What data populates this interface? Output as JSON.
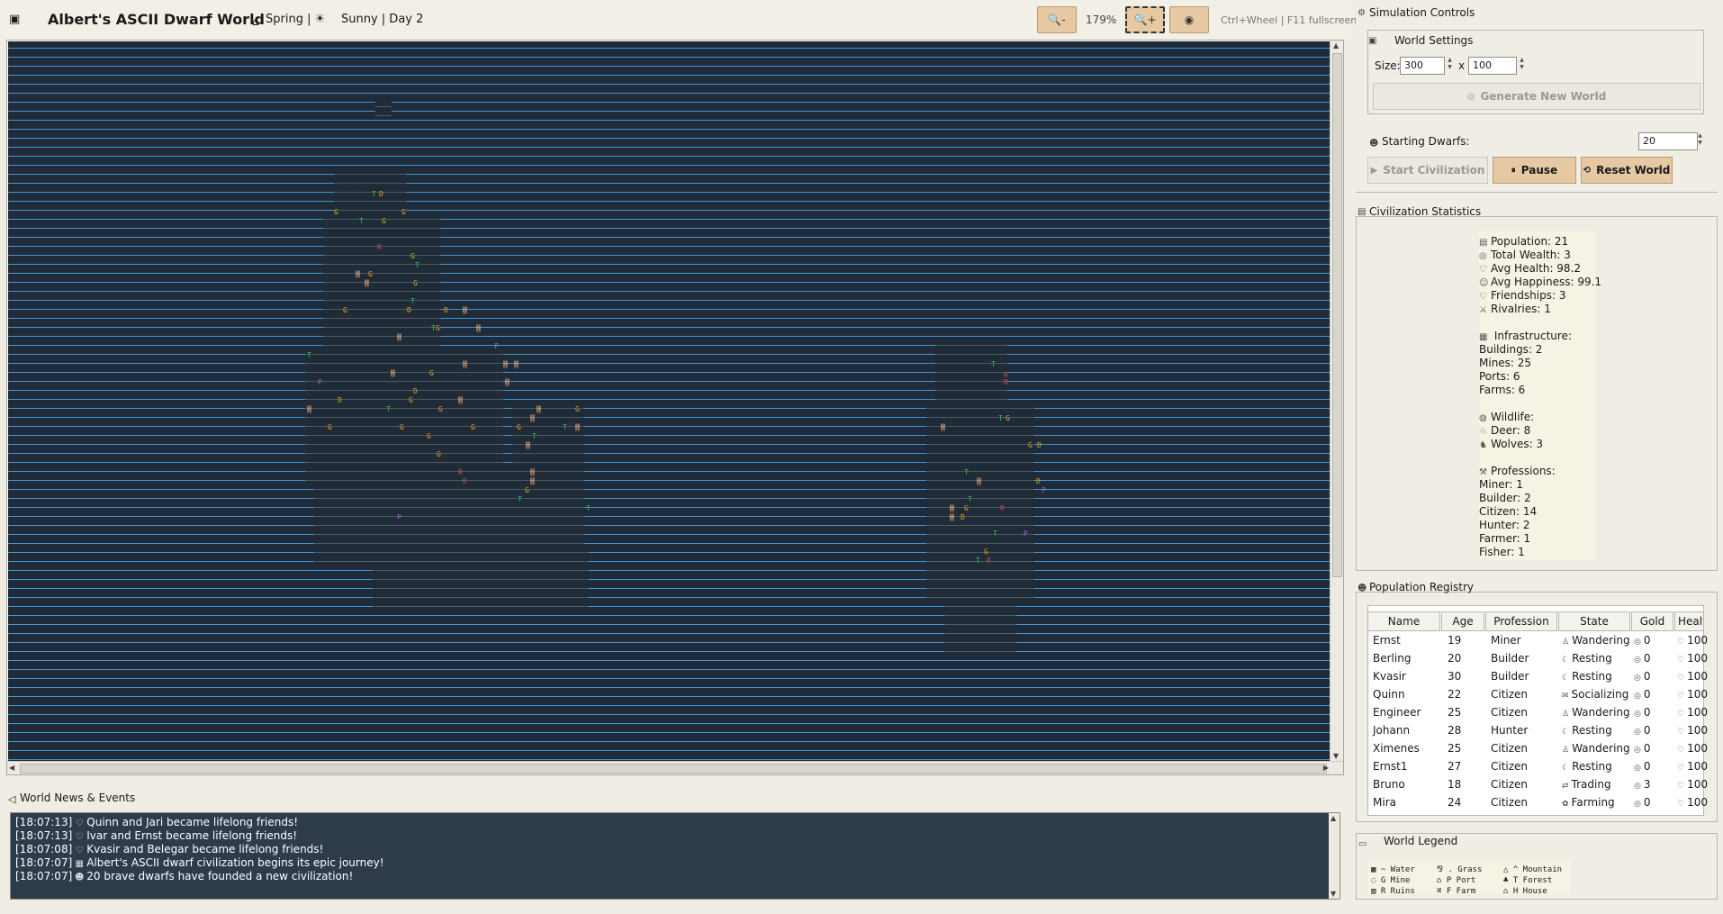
{
  "header": {
    "title": "Albert's ASCII Dwarf World",
    "season": "Spring | ☀",
    "weather_day": "Sunny | Day 2",
    "zoom_level": "179%",
    "hint": "Ctrl+Wheel | F11 fullscreen"
  },
  "map": {
    "glyph_colors": {
      "G": "#e8a317",
      "T": "#33c24a",
      "D": "#e8a317",
      "P": "#b05fd0",
      "R": "#c05050",
      "H": "#d28a5a"
    }
  },
  "news": {
    "title": "World News & Events",
    "events": [
      {
        "time": "[18:07:13]",
        "icon": "heart-icon",
        "text": "Quinn and Jari became lifelong friends!"
      },
      {
        "time": "[18:07:13]",
        "icon": "heart-icon",
        "text": "Ivar and Ernst became lifelong friends!"
      },
      {
        "time": "[18:07:08]",
        "icon": "heart-icon",
        "text": "Kvasir and Belegar became lifelong friends!"
      },
      {
        "time": "[18:07:07]",
        "icon": "building-icon",
        "text": "Albert's ASCII dwarf civilization begins its epic journey!"
      },
      {
        "time": "[18:07:07]",
        "icon": "dwarf-icon",
        "text": "20 brave dwarfs have founded a new civilization!"
      }
    ]
  },
  "controls": {
    "title": "Simulation Controls",
    "world_settings": "World Settings",
    "size_label": "Size:",
    "size_x": "300",
    "size_sep": "x",
    "size_y": "100",
    "generate_label": "Generate New World",
    "starting_dwarfs_label": "Starting Dwarfs:",
    "starting_dwarfs": "20",
    "start_label": "Start Civilization",
    "pause_label": "Pause",
    "reset_label": "Reset World"
  },
  "stats": {
    "title": "Civilization Statistics",
    "population": "Population: 21",
    "wealth": "Total Wealth: 3",
    "health": "Avg Health: 98.2",
    "happiness": "Avg Happiness: 99.1",
    "friendships": "Friendships: 3",
    "rivalries": "Rivalries: 1",
    "infra_title": "Infrastructure:",
    "buildings": "Buildings: 2",
    "mines": "Mines: 25",
    "ports": "Ports: 6",
    "farms": "Farms: 6",
    "wildlife_title": "Wildlife:",
    "deer": "Deer: 8",
    "wolves": "Wolves: 3",
    "prof_title": "Professions:",
    "miner": "Miner: 1",
    "builder": "Builder: 2",
    "citizen": "Citizen: 14",
    "hunter": "Hunter: 2",
    "farmer": "Farmer: 1",
    "fisher": "Fisher: 1"
  },
  "registry": {
    "title": "Population Registry",
    "columns": [
      "Name",
      "Age",
      "Profession",
      "State",
      "Gold",
      "Healt"
    ],
    "rows": [
      {
        "name": "Ernst",
        "age": "19",
        "profession": "Miner",
        "state": "Wandering",
        "gold": "0",
        "health": "100"
      },
      {
        "name": "Berling",
        "age": "20",
        "profession": "Builder",
        "state": "Resting",
        "gold": "0",
        "health": "100"
      },
      {
        "name": "Kvasir",
        "age": "30",
        "profession": "Builder",
        "state": "Resting",
        "gold": "0",
        "health": "100"
      },
      {
        "name": "Quinn",
        "age": "22",
        "profession": "Citizen",
        "state": "Socializing",
        "gold": "0",
        "health": "100"
      },
      {
        "name": "Engineer",
        "age": "25",
        "profession": "Citizen",
        "state": "Wandering",
        "gold": "0",
        "health": "100"
      },
      {
        "name": "Johann",
        "age": "28",
        "profession": "Hunter",
        "state": "Resting",
        "gold": "0",
        "health": "100"
      },
      {
        "name": "Ximenes",
        "age": "25",
        "profession": "Citizen",
        "state": "Wandering",
        "gold": "0",
        "health": "100"
      },
      {
        "name": "Ernst1",
        "age": "27",
        "profession": "Citizen",
        "state": "Resting",
        "gold": "0",
        "health": "100"
      },
      {
        "name": "Bruno",
        "age": "18",
        "profession": "Citizen",
        "state": "Trading",
        "gold": "3",
        "health": "100"
      },
      {
        "name": "Mira",
        "age": "24",
        "profession": "Citizen",
        "state": "Farming",
        "gold": "0",
        "health": "100"
      }
    ]
  },
  "legend": {
    "title": "World Legend",
    "items": [
      "~ Water",
      ". Grass",
      "^ Mountain",
      "G Mine",
      "P Port",
      "T Forest",
      "R Ruins",
      "F Farm",
      "H House"
    ]
  }
}
